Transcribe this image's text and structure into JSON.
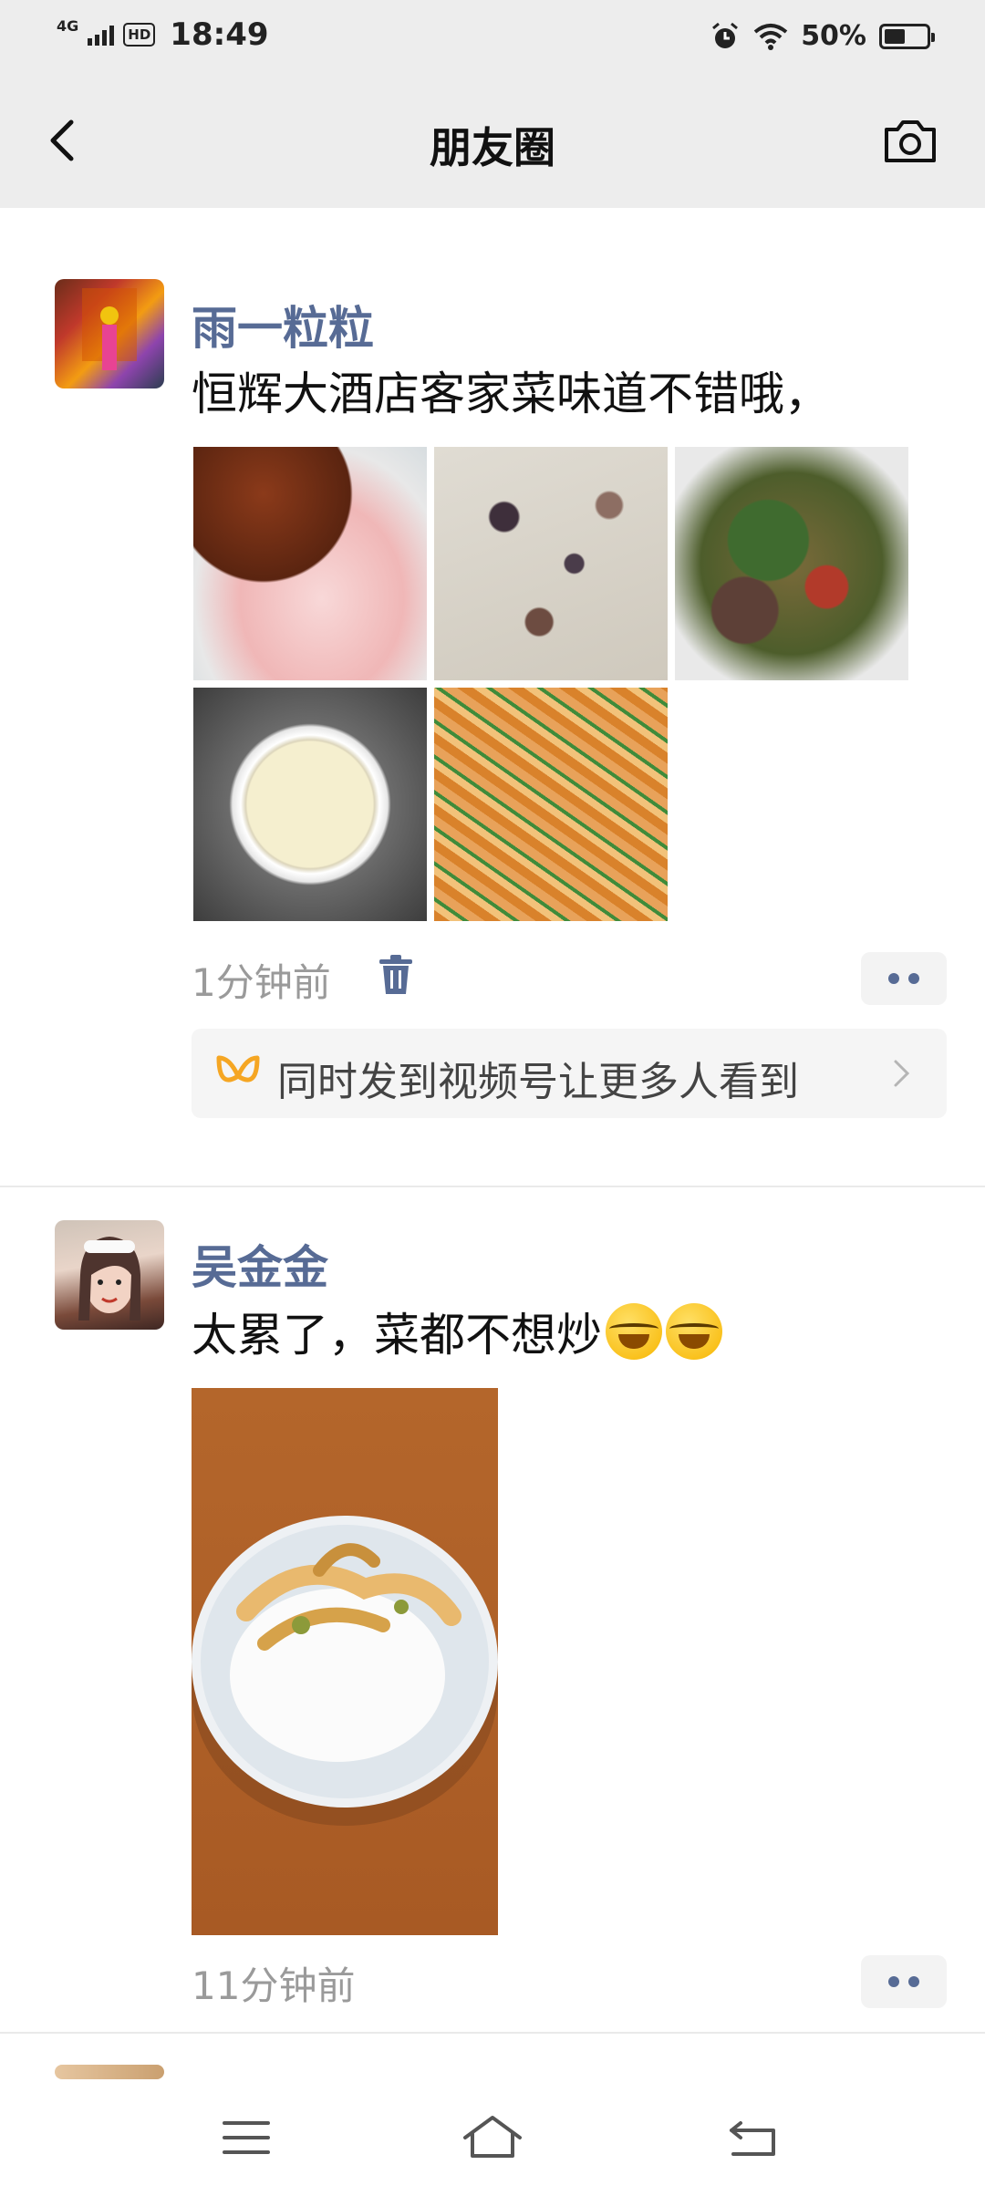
{
  "status_bar": {
    "network": "4G",
    "hd": "HD",
    "time": "18:49",
    "battery": "50%",
    "battery_level": 0.5
  },
  "nav": {
    "title": "朋友圈",
    "back_icon": "chevron-left-icon",
    "camera_icon": "camera-icon"
  },
  "posts": [
    {
      "author": "雨一粒粒",
      "text": "恒辉大酒店客家菜味道不错哦，",
      "time": "1分钟前",
      "photos": 5,
      "promo_text": "同时发到视频号让更多人看到"
    },
    {
      "author": "吴金金",
      "text": "太累了，菜都不想炒",
      "time": "11分钟前",
      "photos": 1
    }
  ],
  "colors": {
    "link_blue": "#576b95",
    "bar_gray": "#ededed",
    "promo_orange": "#f5a623"
  },
  "bottom_nav_icons": [
    "menu-icon",
    "home-icon",
    "back-icon"
  ]
}
